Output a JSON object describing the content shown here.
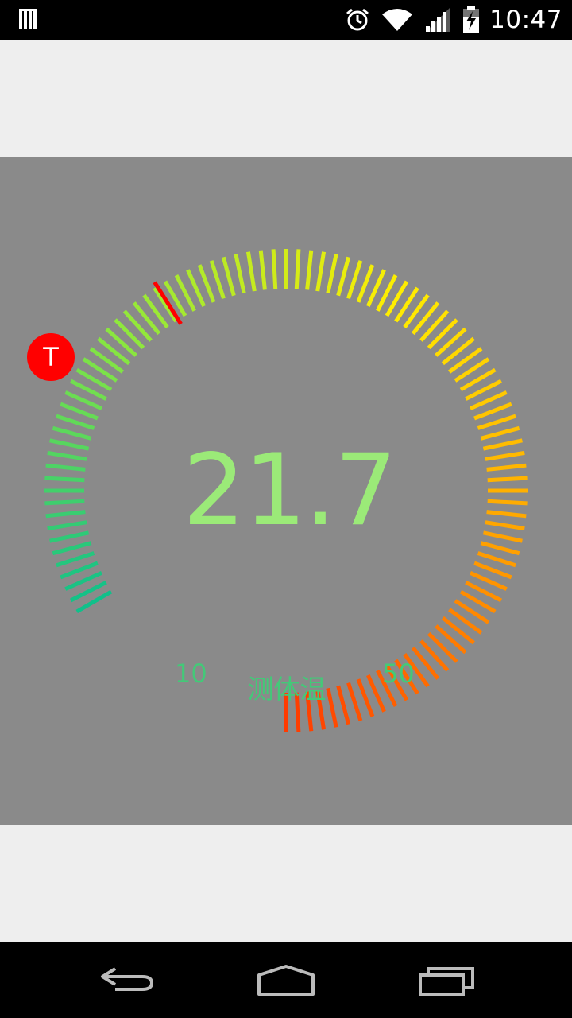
{
  "status_bar": {
    "time": "10:47",
    "icons": [
      "notification-icon",
      "alarm-icon",
      "wifi-icon",
      "cell-signal-icon",
      "battery-charging-icon"
    ]
  },
  "gauge": {
    "value": "21.7",
    "min_label": "10",
    "max_label": "50",
    "caption": "测体温",
    "knob_label": "T",
    "min": 10,
    "max": 50,
    "current": 21.7,
    "colors": {
      "panel": "#8a8a8a",
      "readout": "#9bea78",
      "labels": "#43c978",
      "knob": "#ff0000",
      "gradient": [
        "#10c08a",
        "#8fe83c",
        "#ffee00",
        "#ffa000",
        "#ff3a00"
      ]
    }
  },
  "nav_bar": {
    "buttons": [
      "back-icon",
      "home-icon",
      "recents-icon"
    ]
  }
}
